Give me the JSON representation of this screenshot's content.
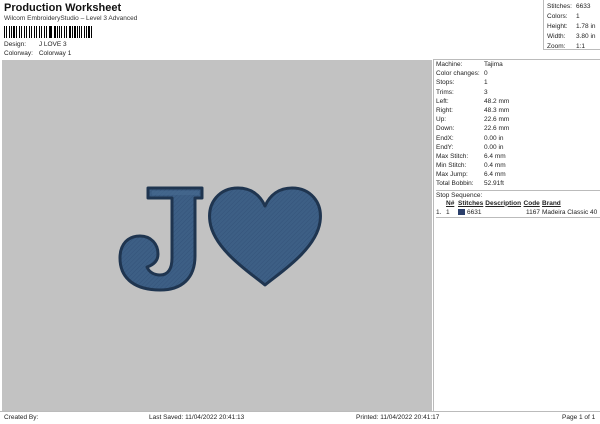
{
  "header": {
    "title": "Production Worksheet",
    "subtitle": "Wilcom EmbroideryStudio – Level 3 Advanced",
    "design_label": "Design:",
    "design_value": "J LOVE 3",
    "colorway_label": "Colorway:",
    "colorway_value": "Colorway 1"
  },
  "stats": [
    {
      "label": "Stitches:",
      "value": "6633"
    },
    {
      "label": "Colors:",
      "value": "1"
    },
    {
      "label": "Height:",
      "value": "1.78 in"
    },
    {
      "label": "Width:",
      "value": "3.80 in"
    },
    {
      "label": "Zoom:",
      "value": "1:1"
    }
  ],
  "machine_info": [
    {
      "label": "Machine:",
      "value": "Tajima"
    },
    {
      "label": "Color changes:",
      "value": "0"
    },
    {
      "label": "Stops:",
      "value": "1"
    },
    {
      "label": "Trims:",
      "value": "3"
    },
    {
      "label": "Left:",
      "value": "48.2 mm"
    },
    {
      "label": "Right:",
      "value": "48.3 mm"
    },
    {
      "label": "Up:",
      "value": "22.6 mm"
    },
    {
      "label": "Down:",
      "value": "22.6 mm"
    },
    {
      "label": "EndX:",
      "value": "0.00 in"
    },
    {
      "label": "EndY:",
      "value": "0.00 in"
    },
    {
      "label": "Max Stitch:",
      "value": "6.4 mm"
    },
    {
      "label": "Min Stitch:",
      "value": "0.4 mm"
    },
    {
      "label": "Max Jump:",
      "value": "6.4 mm"
    },
    {
      "label": "Total Bobbin:",
      "value": "52.91ft"
    }
  ],
  "stop_sequence": {
    "label": "Stop Sequence:",
    "headers": [
      "N#",
      "Stitches",
      "Description",
      "Code",
      "Brand"
    ],
    "rows": [
      {
        "index": "1.",
        "n": "1",
        "swatch_color": "#2b3f6b",
        "stitches": "6631",
        "description": "",
        "code": "1167",
        "brand": "Madeira Classic 40"
      }
    ]
  },
  "design": {
    "letter": "J",
    "fill_color": "#3d5f85",
    "outline_color": "#1f3550",
    "background": "#c2c2c2"
  },
  "footer": {
    "created_by": "Created By:",
    "last_saved": "Last Saved: 11/04/2022 20:41:13",
    "printed": "Printed: 11/04/2022 20:41:17",
    "page": "Page 1 of 1"
  }
}
